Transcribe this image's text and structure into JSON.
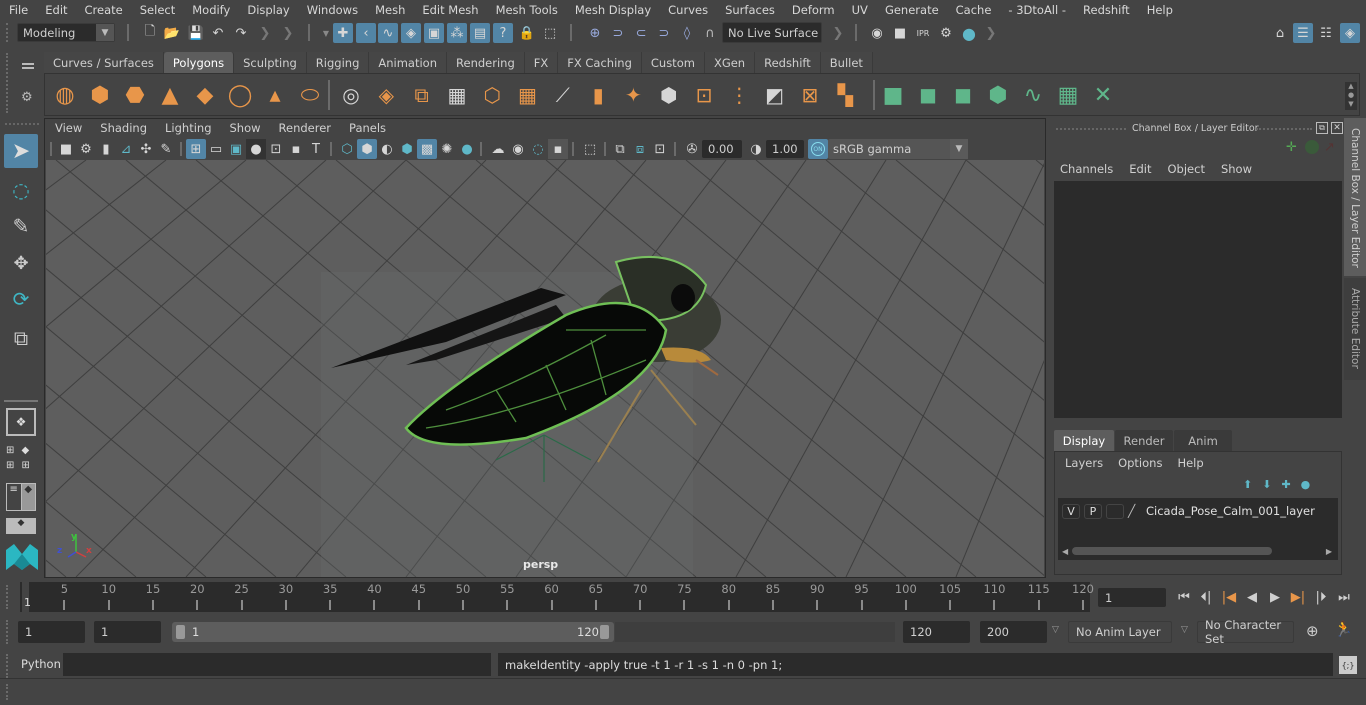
{
  "menubar": [
    "File",
    "Edit",
    "Create",
    "Select",
    "Modify",
    "Display",
    "Windows",
    "Mesh",
    "Edit Mesh",
    "Mesh Tools",
    "Mesh Display",
    "Curves",
    "Surfaces",
    "Deform",
    "UV",
    "Generate",
    "Cache",
    "- 3DtoAll -",
    "Redshift",
    "Help"
  ],
  "statusline": {
    "menuset": "Modeling",
    "live_surface": "No Live Surface",
    "icons": [
      "new-scene-icon",
      "open-scene-icon",
      "save-scene-icon",
      "undo-icon",
      "redo-icon",
      "select-by-hierarchy-icon",
      "select-by-object-icon",
      "select-by-component-icon",
      "snap-grid-icon",
      "snap-curve-icon",
      "snap-point-icon",
      "snap-view-icon",
      "snap-surface-icon",
      "lock-icon",
      "select-highlight-icon",
      "render-view-icon",
      "render-icon",
      "ipr-render-icon",
      "render-settings-icon",
      "hypershade-icon",
      "modeling-toolkit-icon",
      "channel-box-toggle-icon",
      "attribute-editor-toggle-icon",
      "layer-editor-toggle-icon"
    ]
  },
  "shelf": {
    "tabs": [
      "Curves / Surfaces",
      "Polygons",
      "Sculpting",
      "Rigging",
      "Animation",
      "Rendering",
      "FX",
      "FX Caching",
      "Custom",
      "XGen",
      "Redshift",
      "Bullet"
    ],
    "active_tab": "Polygons",
    "primitive_icons": [
      "poly-sphere-icon",
      "poly-cube-icon",
      "poly-cylinder-icon",
      "poly-cone-icon",
      "poly-plane-icon",
      "poly-torus-icon",
      "poly-pyramid-icon",
      "poly-pipe-icon"
    ],
    "tool_icons": [
      "combine-icon",
      "separate-icon",
      "mirror-icon",
      "smooth-icon",
      "extrude-icon",
      "bridge-icon",
      "multi-cut-icon",
      "bevel-icon",
      "fill-hole-icon",
      "append-icon",
      "insert-edge-loop-icon",
      "edge-loop-icon",
      "merge-icon",
      "target-weld-icon",
      "quad-draw-icon"
    ],
    "uv_icons": [
      "planar-uv-icon",
      "cylindrical-uv-icon",
      "spherical-uv-icon",
      "automatic-uv-icon",
      "unfold-uv-icon",
      "uv-editor-icon",
      "cut-uv-icon"
    ],
    "accent_orange": "#e8964a",
    "accent_green": "#5fb68a"
  },
  "viewport": {
    "menu": [
      "View",
      "Shading",
      "Lighting",
      "Show",
      "Renderer",
      "Panels"
    ],
    "exposure": "0.00",
    "gamma": "1.00",
    "color_mgmt": "ON",
    "colorspace": "sRGB gamma",
    "camera_label": "persp",
    "axis": {
      "x": "x",
      "y": "y",
      "z": "z"
    }
  },
  "right_panel": {
    "title": "Channel Box / Layer Editor",
    "channel_menu": [
      "Channels",
      "Edit",
      "Object",
      "Show"
    ],
    "layer_tabs": [
      "Display",
      "Render",
      "Anim"
    ],
    "active_layer_tab": "Display",
    "layer_menu": [
      "Layers",
      "Options",
      "Help"
    ],
    "layers": [
      {
        "v": "V",
        "p": "P",
        "name": "Cicada_Pose_Calm_001_layer"
      }
    ],
    "side_tabs": [
      "Channel Box / Layer Editor",
      "Attribute Editor"
    ]
  },
  "timeline": {
    "start_frame": "1",
    "ticks": [
      5,
      10,
      15,
      20,
      25,
      30,
      35,
      40,
      45,
      50,
      55,
      60,
      65,
      70,
      75,
      80,
      85,
      90,
      95,
      100,
      105,
      110,
      115,
      120
    ],
    "range_min": 1,
    "range_max": 120,
    "current_frame": "1",
    "current_frame_field": "1"
  },
  "range": {
    "start": "1",
    "playback_start": "1",
    "slider_start": "1",
    "slider_end": "120",
    "playback_end": "120",
    "end": "200",
    "anim_layer": "No Anim Layer",
    "character_set": "No Character Set"
  },
  "command": {
    "language": "Python",
    "input": "",
    "result": "makeIdentity -apply true -t 1 -r 1 -s 1 -n 0 -pn 1;"
  },
  "colors": {
    "bg": "#444444",
    "field": "#2b2b2b",
    "selected": "#5285a6",
    "viewport": "#5e5e5e"
  }
}
